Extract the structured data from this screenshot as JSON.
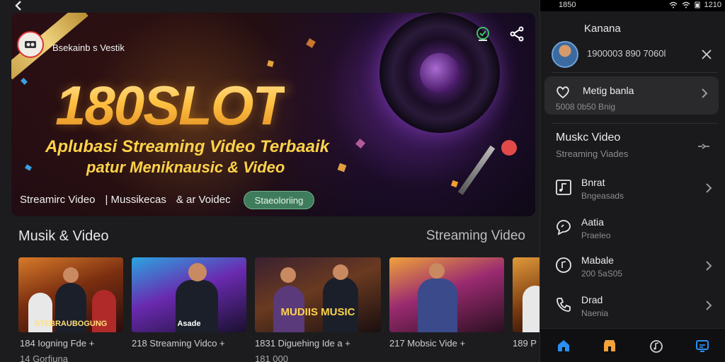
{
  "colors": {
    "accent_blue": "#2a8ff0",
    "accent_orange": "#f2a33a",
    "pill_green": "#3f7b5d",
    "banner_gold": "#ffc84a"
  },
  "header": {
    "back_icon": "chevron-left-icon"
  },
  "banner": {
    "brand_name": "Bsekainb s Vestik",
    "title": "180SLOT",
    "subtitle_line1": "Aplubasi Streaming Video Terbaaik",
    "subtitle_line2": "patur Meniknausic & Video",
    "icons": [
      "bookmark-icon",
      "share-icon"
    ],
    "tabs": [
      "Streamirc Video",
      "| Mussikecas",
      "& ar Voidec"
    ],
    "pill": "Staeoloriing"
  },
  "section": {
    "title": "Musik & Video",
    "right_label": "Streaming Video"
  },
  "thumbnails": [
    {
      "caption": "STEBRAUBOGUNG"
    },
    {
      "caption": "Asade"
    },
    {
      "caption": "MUDIIS MUSIC"
    },
    {
      "caption": ""
    },
    {
      "caption": ""
    }
  ],
  "meta_row": [
    "184  Iogning Fde +",
    "218  Streaming Vidco +",
    "1831  Diguehing Ide a +",
    "217  Mobsic Vide +",
    "189  P"
  ],
  "meta_row2": [
    "14  Gorfiuna",
    "",
    "181 000",
    "",
    ""
  ],
  "panel": {
    "status_time": "1850",
    "status_right": "1210",
    "title": "Kanana",
    "profile_text": "1900003 890 7060l",
    "card": {
      "title": "Metig banla",
      "subtitle": "5008 0b50 Bnig"
    },
    "section_title": "Muskc Video",
    "section_subtitle": "Streaming Viades",
    "items": [
      {
        "title": "Bnrat",
        "subtitle": "Bngeasads",
        "icon": "music-note-icon"
      },
      {
        "title": "Aatia",
        "subtitle": "Praeleo",
        "icon": "chat-bubble-icon"
      },
      {
        "title": "Mabale",
        "subtitle": "200 5aS05",
        "icon": "mobile-music-icon"
      },
      {
        "title": "Drad",
        "subtitle": "Naenia",
        "icon": "phone-icon"
      }
    ],
    "nav": [
      "home-icon",
      "store-icon",
      "music-icon",
      "screen-cast-icon"
    ]
  }
}
